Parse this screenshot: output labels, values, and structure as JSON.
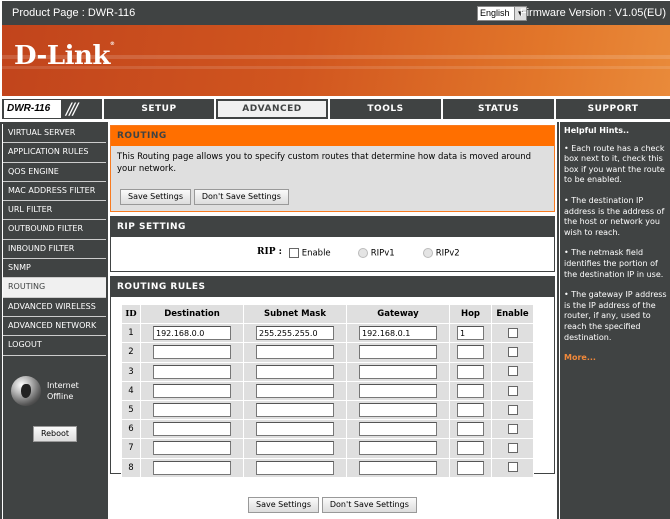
{
  "topbar": {
    "product_page": "Product Page :  DWR-116",
    "language": "English",
    "firmware": "Firmware Version : V1.05(EU)"
  },
  "banner": {
    "logo": "D-Link"
  },
  "model_label": "DWR-116",
  "tabs": [
    {
      "label": "SETUP",
      "active": false
    },
    {
      "label": "ADVANCED",
      "active": true
    },
    {
      "label": "TOOLS",
      "active": false
    },
    {
      "label": "STATUS",
      "active": false
    },
    {
      "label": "SUPPORT",
      "active": false
    }
  ],
  "sidebar": {
    "items": [
      {
        "label": "VIRTUAL SERVER"
      },
      {
        "label": "APPLICATION RULES"
      },
      {
        "label": "QOS ENGINE"
      },
      {
        "label": "MAC ADDRESS FILTER"
      },
      {
        "label": "URL FILTER"
      },
      {
        "label": "OUTBOUND FILTER"
      },
      {
        "label": "INBOUND FILTER"
      },
      {
        "label": "SNMP"
      },
      {
        "label": "ROUTING"
      },
      {
        "label": "ADVANCED WIRELESS"
      },
      {
        "label": "ADVANCED NETWORK"
      },
      {
        "label": "LOGOUT"
      }
    ],
    "active_index": 8,
    "internet_status_line1": "Internet",
    "internet_status_line2": "Offline",
    "reboot_label": "Reboot"
  },
  "routing": {
    "title": "ROUTING",
    "description": "This Routing page allows you to specify custom routes that determine how data is moved around your network.",
    "save_label": "Save Settings",
    "dont_save_label": "Don't Save Settings"
  },
  "rip": {
    "title": "RIP SETTING",
    "label": "RIP :",
    "enable_label": "Enable",
    "enabled": false,
    "ripv1_label": "RIPv1",
    "ripv2_label": "RIPv2"
  },
  "rules": {
    "title": "ROUTING RULES",
    "columns": [
      "ID",
      "Destination",
      "Subnet Mask",
      "Gateway",
      "Hop",
      "Enable"
    ],
    "rows": [
      {
        "id": "1",
        "destination": "192.168.0.0",
        "mask": "255.255.255.0",
        "gateway": "192.168.0.1",
        "hop": "1",
        "enabled": false
      },
      {
        "id": "2",
        "destination": "",
        "mask": "",
        "gateway": "",
        "hop": "",
        "enabled": false
      },
      {
        "id": "3",
        "destination": "",
        "mask": "",
        "gateway": "",
        "hop": "",
        "enabled": false
      },
      {
        "id": "4",
        "destination": "",
        "mask": "",
        "gateway": "",
        "hop": "",
        "enabled": false
      },
      {
        "id": "5",
        "destination": "",
        "mask": "",
        "gateway": "",
        "hop": "",
        "enabled": false
      },
      {
        "id": "6",
        "destination": "",
        "mask": "",
        "gateway": "",
        "hop": "",
        "enabled": false
      },
      {
        "id": "7",
        "destination": "",
        "mask": "",
        "gateway": "",
        "hop": "",
        "enabled": false
      },
      {
        "id": "8",
        "destination": "",
        "mask": "",
        "gateway": "",
        "hop": "",
        "enabled": false
      }
    ]
  },
  "bottom": {
    "save_label": "Save Settings",
    "dont_save_label": "Don't Save Settings"
  },
  "hints": {
    "title": "Helpful Hints..",
    "items": [
      "• Each route has a check box next to it, check this box if you want the route to be enabled.",
      "• The destination IP address is the address of the host or network you wish to reach.",
      "• The netmask field identifies the portion of the destination IP in use.",
      "• The gateway IP address is the IP address of the router, if any, used to reach the specified destination."
    ],
    "more_label": "More..."
  },
  "colors": {
    "dark": "#404343",
    "orange_header": "#ff6f00",
    "hint_link": "#f0883a"
  }
}
